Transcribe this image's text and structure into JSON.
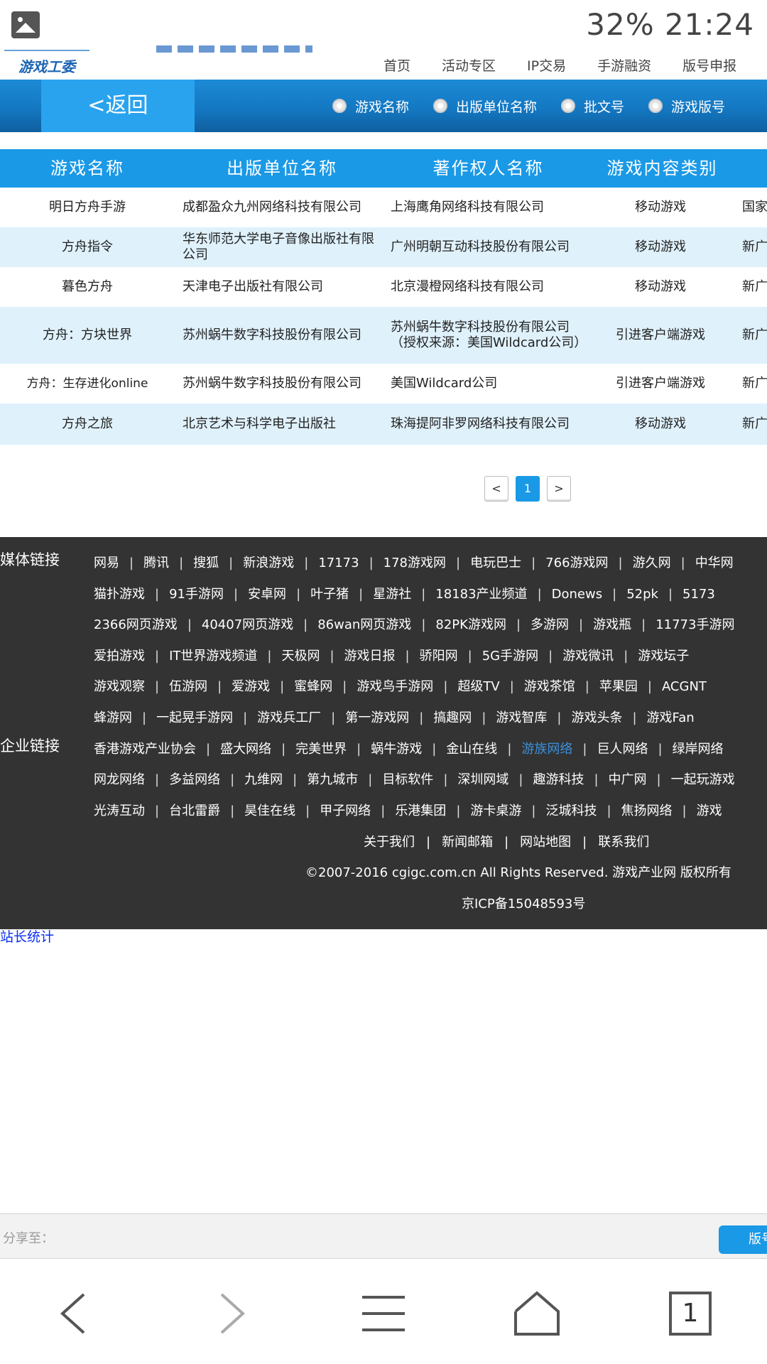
{
  "status_bar": {
    "text": "32% 21:24"
  },
  "header": {
    "logo_text": "游戏工委",
    "nav": [
      "首页",
      "活动专区",
      "IP交易",
      "手游融资",
      "版号申报"
    ]
  },
  "toolbar": {
    "back_label": "<返回",
    "radio_options": [
      "游戏名称",
      "出版单位名称",
      "批文号",
      "游戏版号"
    ]
  },
  "table": {
    "headers": [
      "游戏名称",
      "出版单位名称",
      "著作权人名称",
      "游戏内容类别"
    ],
    "rows": [
      [
        "明日方舟手游",
        "成都盈众九州网络科技有限公司",
        "上海鹰角网络科技有限公司",
        "移动游戏",
        "国家"
      ],
      [
        "方舟指令",
        "华东师范大学电子音像出版社有限公司",
        "广州明朝互动科技股份有限公司",
        "移动游戏",
        "新广"
      ],
      [
        "暮色方舟",
        "天津电子出版社有限公司",
        "北京漫橙网络科技有限公司",
        "移动游戏",
        "新广"
      ],
      [
        "方舟：方块世界",
        "苏州蜗牛数字科技股份有限公司",
        "苏州蜗牛数字科技股份有限公司（授权来源：美国Wildcard公司）",
        "引进客户端游戏",
        "新广"
      ],
      [
        "方舟：生存进化online",
        "苏州蜗牛数字科技股份有限公司",
        "美国Wildcard公司",
        "引进客户端游戏",
        "新广"
      ],
      [
        "方舟之旅",
        "北京艺术与科学电子出版社",
        "珠海提阿非罗网络科技有限公司",
        "移动游戏",
        "新广"
      ]
    ]
  },
  "pagination": {
    "prev": "<",
    "current": "1",
    "next": ">"
  },
  "footer": {
    "media_title": "媒体链接",
    "company_title": "企业链接",
    "lines": [
      [
        "网易",
        "腾讯",
        "搜狐",
        "新浪游戏",
        "17173",
        "178游戏网",
        "电玩巴士",
        "766游戏网",
        "游久网",
        "中华网"
      ],
      [
        "猫扑游戏",
        "91手游网",
        "安卓网",
        "叶子猪",
        "星游社",
        "18183产业频道",
        "Donews",
        "52pk",
        "5173"
      ],
      [
        "2366网页游戏",
        "40407网页游戏",
        "86wan网页游戏",
        "82PK游戏网",
        "多游网",
        "游戏瓶",
        "11773手游网"
      ],
      [
        "爱拍游戏",
        "IT世界游戏频道",
        "天极网",
        "游戏日报",
        "骄阳网",
        "5G手游网",
        "游戏微讯",
        "游戏坛子"
      ],
      [
        "游戏观察",
        "伍游网",
        "爱游戏",
        "蜜蜂网",
        "游戏鸟手游网",
        "超级TV",
        "游戏茶馆",
        "苹果园",
        "ACGNT"
      ],
      [
        "蜂游网",
        "一起晃手游网",
        "游戏兵工厂",
        "第一游戏网",
        "搞趣网",
        "游戏智库",
        "游戏头条",
        "游戏Fan"
      ],
      [
        "香港游戏产业协会",
        "盛大网络",
        "完美世界",
        "蜗牛游戏",
        "金山在线",
        "游族网络",
        "巨人网络",
        "绿岸网络"
      ],
      [
        "网龙网络",
        "多益网络",
        "九维网",
        "第九城市",
        "目标软件",
        "深圳网域",
        "趣游科技",
        "中广网",
        "一起玩游戏"
      ],
      [
        "光涛互动",
        "台北雷爵",
        "昊佳在线",
        "甲子网络",
        "乐港集团",
        "游卡桌游",
        "泛城科技",
        "焦扬网络",
        "游戏"
      ]
    ],
    "highlight_link": "游族网络",
    "bottom_links": [
      "关于我们",
      "新闻邮箱",
      "网站地图",
      "联系我们"
    ],
    "copyright": "©2007-2016 cgigc.com.cn All Rights Reserved. 游戏产业网 版权所有",
    "icp": "京ICP备15048593号"
  },
  "stats_link": "站长统计",
  "share": {
    "label": "分享至：",
    "button": "版号"
  },
  "browser_nav": {
    "tabs_count": "1"
  }
}
